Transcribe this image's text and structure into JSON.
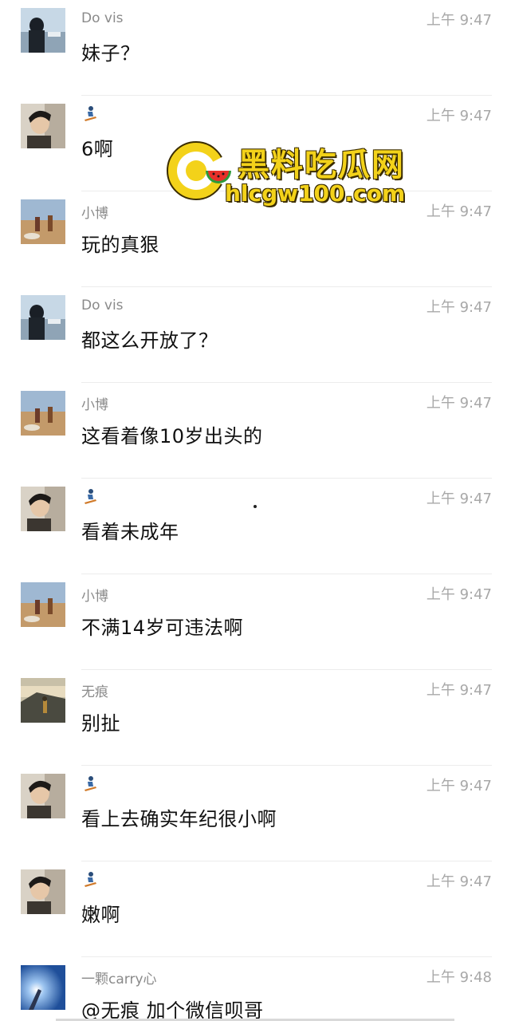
{
  "watermark": {
    "title": "黑料吃瓜网",
    "url": "hlcgw100.com"
  },
  "messages": [
    {
      "sender": "Do vis",
      "avatar": "rock-statue-avatar",
      "time": "上午 9:47",
      "text": "妹子？"
    },
    {
      "sender": "",
      "sender_icon": "snowboarder-icon",
      "avatar": "boy-portrait-avatar",
      "time": "上午 9:47",
      "text": "6啊"
    },
    {
      "sender": "小博",
      "avatar": "field-people-avatar",
      "time": "上午 9:47",
      "text": "玩的真狠"
    },
    {
      "sender": "Do vis",
      "avatar": "rock-statue-avatar",
      "time": "上午 9:47",
      "text": "都这么开放了？"
    },
    {
      "sender": "小博",
      "avatar": "field-people-avatar",
      "time": "上午 9:47",
      "text": "这看着像10岁出头的"
    },
    {
      "sender": "",
      "sender_icon": "snowboarder-icon",
      "avatar": "boy-portrait-avatar",
      "time": "上午 9:47",
      "text": "看着未成年"
    },
    {
      "sender": "小博",
      "avatar": "field-people-avatar",
      "time": "上午 9:47",
      "text": "不满14岁可违法啊"
    },
    {
      "sender": "无痕",
      "avatar": "hiker-landscape-avatar",
      "time": "上午 9:47",
      "text": "别扯"
    },
    {
      "sender": "",
      "sender_icon": "snowboarder-icon",
      "avatar": "boy-portrait-avatar",
      "time": "上午 9:47",
      "text": "看上去确实年纪很小啊"
    },
    {
      "sender": "",
      "sender_icon": "snowboarder-icon",
      "avatar": "boy-portrait-avatar",
      "time": "上午 9:47",
      "text": "嫩啊"
    },
    {
      "sender": "一颗carry心",
      "avatar": "sunburst-sky-avatar",
      "time": "上午 9:48",
      "text": "@无痕 加个微信呗哥"
    }
  ]
}
